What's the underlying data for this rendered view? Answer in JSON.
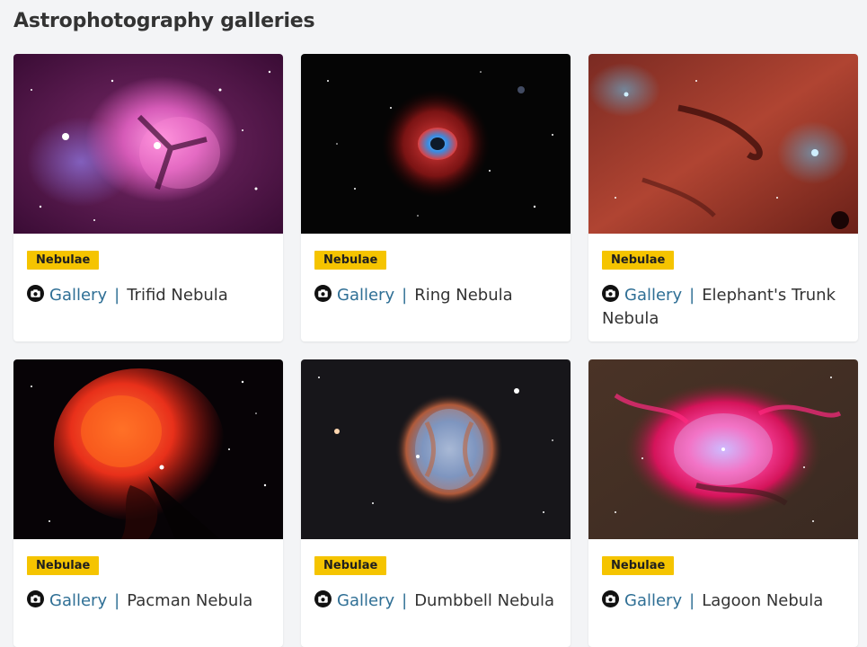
{
  "page": {
    "title": "Astrophotography galleries"
  },
  "cards": [
    {
      "category": "Nebulae",
      "link_label": "Gallery",
      "separator": "|",
      "name": "Trifid Nebula"
    },
    {
      "category": "Nebulae",
      "link_label": "Gallery",
      "separator": "|",
      "name": "Ring Nebula"
    },
    {
      "category": "Nebulae",
      "link_label": "Gallery",
      "separator": "|",
      "name": "Elephant's Trunk Nebula"
    },
    {
      "category": "Nebulae",
      "link_label": "Gallery",
      "separator": "|",
      "name": "Pacman Nebula"
    },
    {
      "category": "Nebulae",
      "link_label": "Gallery",
      "separator": "|",
      "name": "Dumbbell Nebula"
    },
    {
      "category": "Nebulae",
      "link_label": "Gallery",
      "separator": "|",
      "name": "Lagoon Nebula"
    }
  ],
  "icons": {
    "camera": "camera-icon"
  },
  "colors": {
    "background": "#f3f4f6",
    "badge": "#f5c400",
    "link": "#2f6f95",
    "text": "#333333"
  }
}
